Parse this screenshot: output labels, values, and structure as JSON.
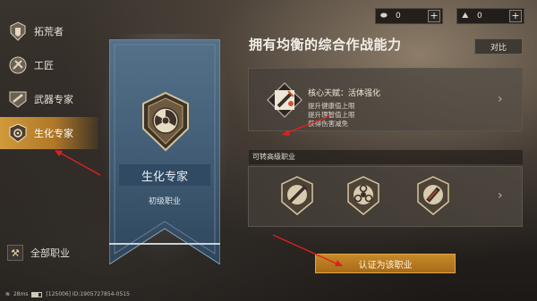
{
  "sidebar": {
    "items": [
      {
        "label": "拓荒者",
        "icon": "pioneer-emblem-icon"
      },
      {
        "label": "工匠",
        "icon": "craftsman-emblem-icon"
      },
      {
        "label": "武器专家",
        "icon": "weapon-expert-emblem-icon"
      },
      {
        "label": "生化专家",
        "icon": "biochem-emblem-icon",
        "active": true
      }
    ],
    "all_jobs_label": "全部职业"
  },
  "status_bar": {
    "ping": "28ms",
    "info": "[125006] ID:1905727854-0515"
  },
  "currency": [
    {
      "icon": "coin-icon",
      "value": "0"
    },
    {
      "icon": "crystal-icon",
      "value": "0"
    }
  ],
  "banner": {
    "emblem": "biohazard-emblem-icon",
    "name": "生化专家",
    "tier": "初级职业"
  },
  "main": {
    "headline": "拥有均衡的综合作战能力",
    "compare_label": "对比",
    "talent": {
      "icon": "syringe-talent-icon",
      "title": "核心天赋：活体强化",
      "lines": [
        "提升健康值上限",
        "提升理智值上限",
        "获得伤害减免"
      ]
    },
    "advanced_header": "可转高级职业",
    "advanced_icons": [
      "syringe-class-icon",
      "biohazard-class-icon",
      "vial-class-icon"
    ],
    "certify_label": "认证为该职业"
  },
  "colors": {
    "accent": "#c68a2a",
    "active_tab": "#d19a3a",
    "banner_blue": "#2f4a62",
    "annotation_red": "#e02020"
  }
}
